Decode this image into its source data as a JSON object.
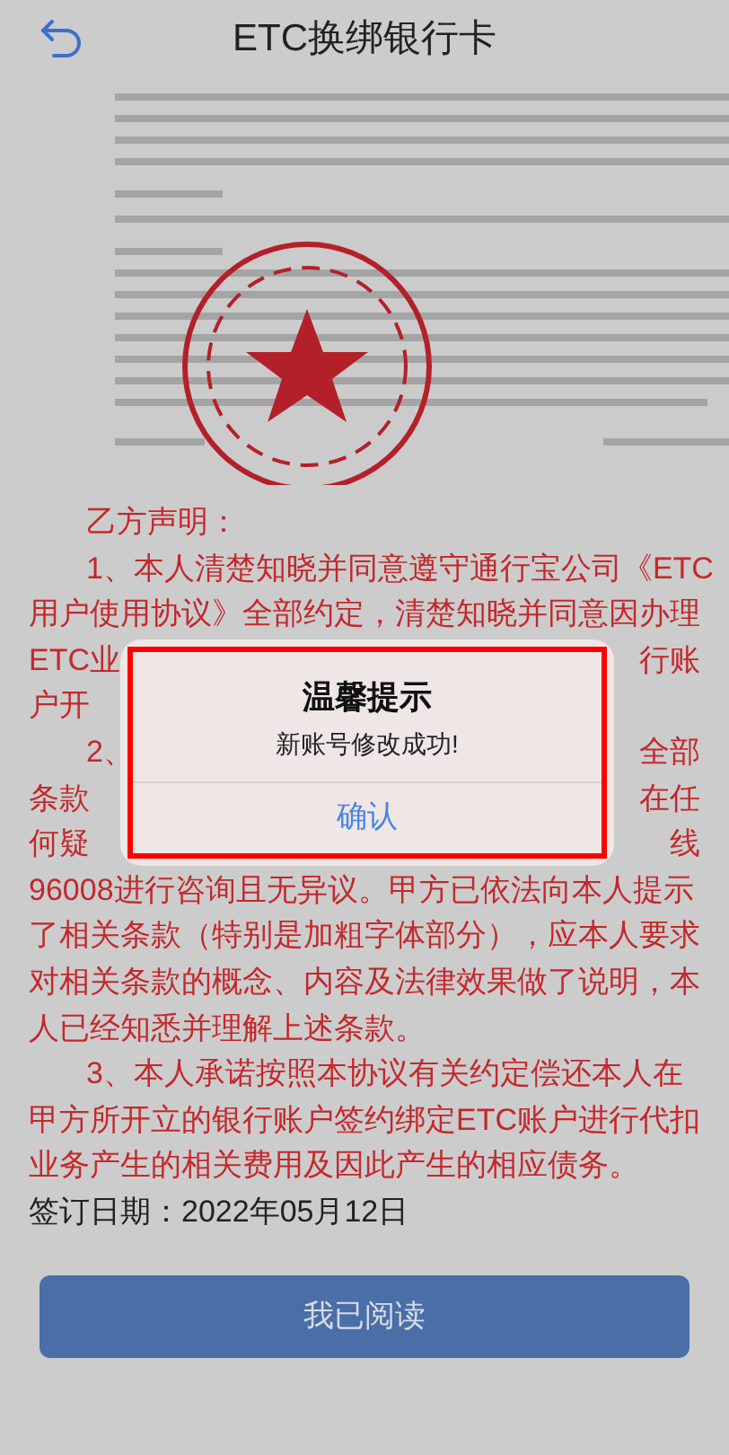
{
  "header": {
    "title": "ETC换绑银行卡"
  },
  "statement": {
    "lines": [
      {
        "left": "乙方声明：",
        "indent": true
      },
      {
        "left": "1、本人清楚知晓并同意遵守通行宝公司《ETC",
        "indent": true
      },
      {
        "left": "用户使用协议》全部约定，清楚知晓并同意因办理",
        "indent": false
      },
      {
        "left": "ETC业",
        "right": "行账",
        "indent": false
      },
      {
        "left": "户开",
        "indent": false
      },
      {
        "left": "2、",
        "right": "全部",
        "indent": true
      },
      {
        "left": "条款",
        "right": "在任",
        "indent": false
      },
      {
        "left": "何疑",
        "right": "线",
        "indent": false
      },
      {
        "left": "96008进行咨询且无异议。甲方已依法向本人提示",
        "indent": false
      },
      {
        "left": "了相关条款（特别是加粗字体部分），应本人要求",
        "indent": false
      },
      {
        "left": "对相关条款的概念、内容及法律效果做了说明，本",
        "indent": false
      },
      {
        "left": "人已经知悉并理解上述条款。",
        "indent": false
      },
      {
        "left": "3、本人承诺按照本协议有关约定偿还本人在",
        "indent": true
      },
      {
        "left": "甲方所开立的银行账户签约绑定ETC账户进行代扣",
        "indent": false
      },
      {
        "left": "业务产生的相关费用及因此产生的相应债务。",
        "indent": false
      }
    ],
    "sign_date": "签订日期：2022年05月12日"
  },
  "dialog": {
    "title": "温馨提示",
    "message": "新账号修改成功!",
    "button": "确认"
  },
  "read_button": "我已阅读"
}
